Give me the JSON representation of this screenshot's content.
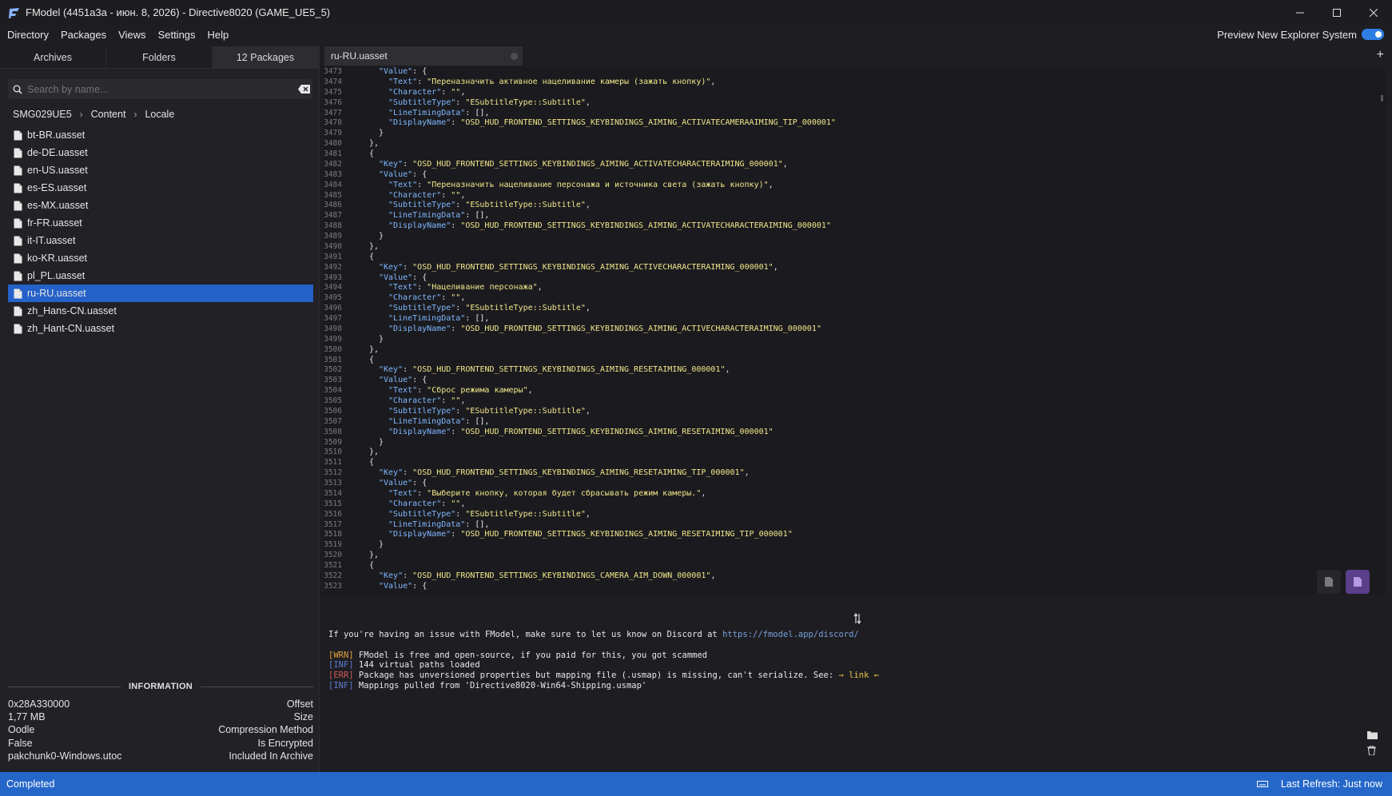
{
  "window": {
    "title": "FModel (4451a3a - июн. 8, 2026) - Directive8020 (GAME_UE5_5)"
  },
  "menu": [
    "Directory",
    "Packages",
    "Views",
    "Settings",
    "Help"
  ],
  "preview_toggle": {
    "label": "Preview New Explorer System",
    "on": true
  },
  "left_tabs": [
    "Archives",
    "Folders",
    "12 Packages"
  ],
  "search": {
    "placeholder": "Search by name..."
  },
  "breadcrumb": [
    "SMG029UE5",
    "Content",
    "Locale"
  ],
  "files": [
    "bt-BR.uasset",
    "de-DE.uasset",
    "en-US.uasset",
    "es-ES.uasset",
    "es-MX.uasset",
    "fr-FR.uasset",
    "it-IT.uasset",
    "ko-KR.uasset",
    "pl_PL.uasset",
    "ru-RU.uasset",
    "zh_Hans-CN.uasset",
    "zh_Hant-CN.uasset"
  ],
  "selected_file": "ru-RU.uasset",
  "information": {
    "title": "INFORMATION",
    "rows": [
      {
        "value": "0x28A330000",
        "label": "Offset"
      },
      {
        "value": "1,77 MB",
        "label": "Size"
      },
      {
        "value": "Oodle",
        "label": "Compression Method"
      },
      {
        "value": "False",
        "label": "Is Encrypted"
      },
      {
        "value": "pakchunk0-Windows.utoc",
        "label": "Included In Archive"
      }
    ]
  },
  "editor": {
    "tab_title": "ru-RU.uasset"
  },
  "code_lines": [
    {
      "n": "3473",
      "i": 6,
      "t": [
        [
          "k",
          "\"Value\""
        ],
        [
          "p",
          ": {"
        ]
      ]
    },
    {
      "n": "3474",
      "i": 8,
      "t": [
        [
          "k",
          "\"Text\""
        ],
        [
          "p",
          ": "
        ],
        [
          "s",
          "\"Переназначить активное нацеливание камеры (зажать кнопку)\""
        ],
        [
          "p",
          ","
        ]
      ]
    },
    {
      "n": "3475",
      "i": 8,
      "t": [
        [
          "k",
          "\"Character\""
        ],
        [
          "p",
          ": "
        ],
        [
          "s",
          "\"\""
        ],
        [
          "p",
          ","
        ]
      ]
    },
    {
      "n": "3476",
      "i": 8,
      "t": [
        [
          "k",
          "\"SubtitleType\""
        ],
        [
          "p",
          ": "
        ],
        [
          "s",
          "\"ESubtitleType::Subtitle\""
        ],
        [
          "p",
          ","
        ]
      ]
    },
    {
      "n": "3477",
      "i": 8,
      "t": [
        [
          "k",
          "\"LineTimingData\""
        ],
        [
          "p",
          ": [],"
        ]
      ]
    },
    {
      "n": "3478",
      "i": 8,
      "t": [
        [
          "k",
          "\"DisplayName\""
        ],
        [
          "p",
          ": "
        ],
        [
          "s",
          "\"OSD_HUD_FRONTEND_SETTINGS_KEYBINDINGS_AIMING_ACTIVATECAMERAAIMING_TIP_000001\""
        ]
      ]
    },
    {
      "n": "3479",
      "i": 6,
      "t": [
        [
          "p",
          "}"
        ]
      ]
    },
    {
      "n": "3480",
      "i": 4,
      "t": [
        [
          "p",
          "},"
        ]
      ]
    },
    {
      "n": "3481",
      "i": 4,
      "t": [
        [
          "p",
          "{"
        ]
      ]
    },
    {
      "n": "3482",
      "i": 6,
      "t": [
        [
          "k",
          "\"Key\""
        ],
        [
          "p",
          ": "
        ],
        [
          "s",
          "\"OSD_HUD_FRONTEND_SETTINGS_KEYBINDINGS_AIMING_ACTIVATECHARACTERAIMING_000001\""
        ],
        [
          "p",
          ","
        ]
      ]
    },
    {
      "n": "3483",
      "i": 6,
      "t": [
        [
          "k",
          "\"Value\""
        ],
        [
          "p",
          ": {"
        ]
      ]
    },
    {
      "n": "3484",
      "i": 8,
      "t": [
        [
          "k",
          "\"Text\""
        ],
        [
          "p",
          ": "
        ],
        [
          "s",
          "\"Переназначить нацеливание персонажа и источника света (зажать кнопку)\""
        ],
        [
          "p",
          ","
        ]
      ]
    },
    {
      "n": "3485",
      "i": 8,
      "t": [
        [
          "k",
          "\"Character\""
        ],
        [
          "p",
          ": "
        ],
        [
          "s",
          "\"\""
        ],
        [
          "p",
          ","
        ]
      ]
    },
    {
      "n": "3486",
      "i": 8,
      "t": [
        [
          "k",
          "\"SubtitleType\""
        ],
        [
          "p",
          ": "
        ],
        [
          "s",
          "\"ESubtitleType::Subtitle\""
        ],
        [
          "p",
          ","
        ]
      ]
    },
    {
      "n": "3487",
      "i": 8,
      "t": [
        [
          "k",
          "\"LineTimingData\""
        ],
        [
          "p",
          ": [],"
        ]
      ]
    },
    {
      "n": "3488",
      "i": 8,
      "t": [
        [
          "k",
          "\"DisplayName\""
        ],
        [
          "p",
          ": "
        ],
        [
          "s",
          "\"OSD_HUD_FRONTEND_SETTINGS_KEYBINDINGS_AIMING_ACTIVATECHARACTERAIMING_000001\""
        ]
      ]
    },
    {
      "n": "3489",
      "i": 6,
      "t": [
        [
          "p",
          "}"
        ]
      ]
    },
    {
      "n": "3490",
      "i": 4,
      "t": [
        [
          "p",
          "},"
        ]
      ]
    },
    {
      "n": "3491",
      "i": 4,
      "t": [
        [
          "p",
          "{"
        ]
      ]
    },
    {
      "n": "3492",
      "i": 6,
      "t": [
        [
          "k",
          "\"Key\""
        ],
        [
          "p",
          ": "
        ],
        [
          "s",
          "\"OSD_HUD_FRONTEND_SETTINGS_KEYBINDINGS_AIMING_ACTIVECHARACTERAIMING_000001\""
        ],
        [
          "p",
          ","
        ]
      ]
    },
    {
      "n": "3493",
      "i": 6,
      "t": [
        [
          "k",
          "\"Value\""
        ],
        [
          "p",
          ": {"
        ]
      ]
    },
    {
      "n": "3494",
      "i": 8,
      "t": [
        [
          "k",
          "\"Text\""
        ],
        [
          "p",
          ": "
        ],
        [
          "s",
          "\"Нацеливание персонажа\""
        ],
        [
          "p",
          ","
        ]
      ]
    },
    {
      "n": "3495",
      "i": 8,
      "t": [
        [
          "k",
          "\"Character\""
        ],
        [
          "p",
          ": "
        ],
        [
          "s",
          "\"\""
        ],
        [
          "p",
          ","
        ]
      ]
    },
    {
      "n": "3496",
      "i": 8,
      "t": [
        [
          "k",
          "\"SubtitleType\""
        ],
        [
          "p",
          ": "
        ],
        [
          "s",
          "\"ESubtitleType::Subtitle\""
        ],
        [
          "p",
          ","
        ]
      ]
    },
    {
      "n": "3497",
      "i": 8,
      "t": [
        [
          "k",
          "\"LineTimingData\""
        ],
        [
          "p",
          ": [],"
        ]
      ]
    },
    {
      "n": "3498",
      "i": 8,
      "t": [
        [
          "k",
          "\"DisplayName\""
        ],
        [
          "p",
          ": "
        ],
        [
          "s",
          "\"OSD_HUD_FRONTEND_SETTINGS_KEYBINDINGS_AIMING_ACTIVECHARACTERAIMING_000001\""
        ]
      ]
    },
    {
      "n": "3499",
      "i": 6,
      "t": [
        [
          "p",
          "}"
        ]
      ]
    },
    {
      "n": "3500",
      "i": 4,
      "t": [
        [
          "p",
          "},"
        ]
      ]
    },
    {
      "n": "3501",
      "i": 4,
      "t": [
        [
          "p",
          "{"
        ]
      ]
    },
    {
      "n": "3502",
      "i": 6,
      "t": [
        [
          "k",
          "\"Key\""
        ],
        [
          "p",
          ": "
        ],
        [
          "s",
          "\"OSD_HUD_FRONTEND_SETTINGS_KEYBINDINGS_AIMING_RESETAIMING_000001\""
        ],
        [
          "p",
          ","
        ]
      ]
    },
    {
      "n": "3503",
      "i": 6,
      "t": [
        [
          "k",
          "\"Value\""
        ],
        [
          "p",
          ": {"
        ]
      ]
    },
    {
      "n": "3504",
      "i": 8,
      "t": [
        [
          "k",
          "\"Text\""
        ],
        [
          "p",
          ": "
        ],
        [
          "s",
          "\"Сброс режима камеры\""
        ],
        [
          "p",
          ","
        ]
      ]
    },
    {
      "n": "3505",
      "i": 8,
      "t": [
        [
          "k",
          "\"Character\""
        ],
        [
          "p",
          ": "
        ],
        [
          "s",
          "\"\""
        ],
        [
          "p",
          ","
        ]
      ]
    },
    {
      "n": "3506",
      "i": 8,
      "t": [
        [
          "k",
          "\"SubtitleType\""
        ],
        [
          "p",
          ": "
        ],
        [
          "s",
          "\"ESubtitleType::Subtitle\""
        ],
        [
          "p",
          ","
        ]
      ]
    },
    {
      "n": "3507",
      "i": 8,
      "t": [
        [
          "k",
          "\"LineTimingData\""
        ],
        [
          "p",
          ": [],"
        ]
      ]
    },
    {
      "n": "3508",
      "i": 8,
      "t": [
        [
          "k",
          "\"DisplayName\""
        ],
        [
          "p",
          ": "
        ],
        [
          "s",
          "\"OSD_HUD_FRONTEND_SETTINGS_KEYBINDINGS_AIMING_RESETAIMING_000001\""
        ]
      ]
    },
    {
      "n": "3509",
      "i": 6,
      "t": [
        [
          "p",
          "}"
        ]
      ]
    },
    {
      "n": "3510",
      "i": 4,
      "t": [
        [
          "p",
          "},"
        ]
      ]
    },
    {
      "n": "3511",
      "i": 4,
      "t": [
        [
          "p",
          "{"
        ]
      ]
    },
    {
      "n": "3512",
      "i": 6,
      "t": [
        [
          "k",
          "\"Key\""
        ],
        [
          "p",
          ": "
        ],
        [
          "s",
          "\"OSD_HUD_FRONTEND_SETTINGS_KEYBINDINGS_AIMING_RESETAIMING_TIP_000001\""
        ],
        [
          "p",
          ","
        ]
      ]
    },
    {
      "n": "3513",
      "i": 6,
      "t": [
        [
          "k",
          "\"Value\""
        ],
        [
          "p",
          ": {"
        ]
      ]
    },
    {
      "n": "3514",
      "i": 8,
      "t": [
        [
          "k",
          "\"Text\""
        ],
        [
          "p",
          ": "
        ],
        [
          "s",
          "\"Выберите кнопку, которая будет сбрасывать режим камеры.\""
        ],
        [
          "p",
          ","
        ]
      ]
    },
    {
      "n": "3515",
      "i": 8,
      "t": [
        [
          "k",
          "\"Character\""
        ],
        [
          "p",
          ": "
        ],
        [
          "s",
          "\"\""
        ],
        [
          "p",
          ","
        ]
      ]
    },
    {
      "n": "3516",
      "i": 8,
      "t": [
        [
          "k",
          "\"SubtitleType\""
        ],
        [
          "p",
          ": "
        ],
        [
          "s",
          "\"ESubtitleType::Subtitle\""
        ],
        [
          "p",
          ","
        ]
      ]
    },
    {
      "n": "3517",
      "i": 8,
      "t": [
        [
          "k",
          "\"LineTimingData\""
        ],
        [
          "p",
          ": [],"
        ]
      ]
    },
    {
      "n": "3518",
      "i": 8,
      "t": [
        [
          "k",
          "\"DisplayName\""
        ],
        [
          "p",
          ": "
        ],
        [
          "s",
          "\"OSD_HUD_FRONTEND_SETTINGS_KEYBINDINGS_AIMING_RESETAIMING_TIP_000001\""
        ]
      ]
    },
    {
      "n": "3519",
      "i": 6,
      "t": [
        [
          "p",
          "}"
        ]
      ]
    },
    {
      "n": "3520",
      "i": 4,
      "t": [
        [
          "p",
          "},"
        ]
      ]
    },
    {
      "n": "3521",
      "i": 4,
      "t": [
        [
          "p",
          "{"
        ]
      ]
    },
    {
      "n": "3522",
      "i": 6,
      "t": [
        [
          "k",
          "\"Key\""
        ],
        [
          "p",
          ": "
        ],
        [
          "s",
          "\"OSD_HUD_FRONTEND_SETTINGS_KEYBINDINGS_CAMERA_AIM_DOWN_000001\""
        ],
        [
          "p",
          ","
        ]
      ]
    },
    {
      "n": "3523",
      "i": 6,
      "t": [
        [
          "k",
          "\"Value\""
        ],
        [
          "p",
          ": {"
        ]
      ]
    }
  ],
  "console": {
    "intro_text": "If you're having an issue with FModel, make sure to let us know on Discord at ",
    "intro_url": "https://fmodel.app/discord/",
    "log": [
      {
        "level": "[WRN]",
        "cls": "wrn",
        "text": " FModel is free and open-source, if you paid for this, you got scammed"
      },
      {
        "level": "[INF]",
        "cls": "inf",
        "text": " 144 virtual paths loaded"
      },
      {
        "level": "[ERR]",
        "cls": "err",
        "text": " Package has unversioned properties but mapping file (.usmap) is missing, can't serialize. See: ",
        "link": "→ link ←"
      },
      {
        "level": "[INF]",
        "cls": "inf",
        "text": " Mappings pulled from 'Directive8020-Win64-Shipping.usmap'"
      }
    ]
  },
  "status": {
    "left": "Completed",
    "last_refresh": "Last Refresh: Just now"
  },
  "colors": {
    "accent": "#2567c9",
    "selected": "#2461c8",
    "json_key": "#7fb7ff",
    "json_string": "#f1e68a"
  }
}
